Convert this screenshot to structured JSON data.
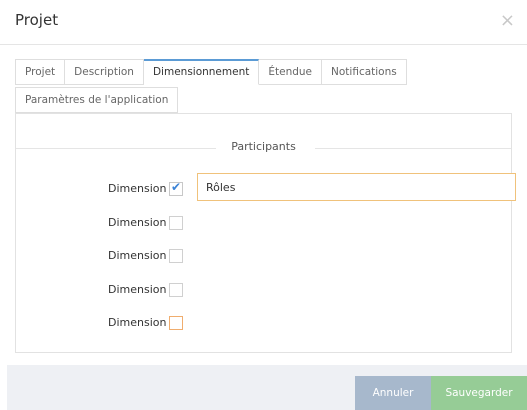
{
  "modal": {
    "title": "Projet",
    "close_glyph": "×"
  },
  "tabs": {
    "row1": [
      {
        "label": "Projet",
        "active": false
      },
      {
        "label": "Description",
        "active": false
      },
      {
        "label": "Dimensionnement",
        "active": true
      },
      {
        "label": "Étendue",
        "active": false
      },
      {
        "label": "Notifications",
        "active": false
      }
    ],
    "row2": [
      {
        "label": "Paramètres de l'application",
        "active": false
      }
    ]
  },
  "panel": {
    "section_title": "Participants",
    "dimensions": [
      {
        "label": "Dimension",
        "checked": true,
        "value": "Rôles"
      },
      {
        "label": "Dimension",
        "checked": false
      },
      {
        "label": "Dimension",
        "checked": false
      },
      {
        "label": "Dimension",
        "checked": false
      },
      {
        "label": "Dimension",
        "checked": false
      }
    ]
  },
  "footer": {
    "cancel_label": "Annuler",
    "save_label": "Sauvegarder"
  },
  "colors": {
    "active_tab_accent": "#5b9bd5",
    "cancel_button": "#a7b8cc",
    "save_button": "#96cc96",
    "focus_border": "#f0ad6e",
    "checkmark": "#3a82d6"
  },
  "icons": {
    "close": "close-icon",
    "check": "check-icon"
  }
}
